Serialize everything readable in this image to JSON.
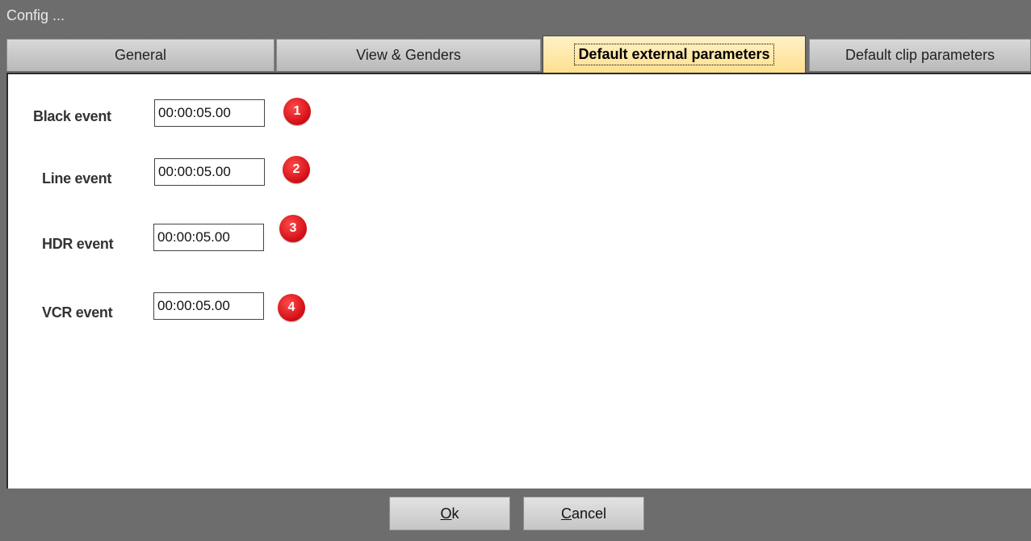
{
  "window": {
    "title": "Config ..."
  },
  "tabs": [
    {
      "label": "General"
    },
    {
      "label": "View & Genders"
    },
    {
      "label": "Default external parameters"
    },
    {
      "label": "Default clip parameters"
    }
  ],
  "fields": [
    {
      "label": "Black event",
      "value": "00:00:05.00",
      "badge": "1"
    },
    {
      "label": "Line event",
      "value": "00:00:05.00",
      "badge": "2"
    },
    {
      "label": "HDR event",
      "value": "00:00:05.00",
      "badge": "3"
    },
    {
      "label": "VCR event",
      "value": "00:00:05.00",
      "badge": "4"
    }
  ],
  "buttons": {
    "ok_mnemonic": "O",
    "ok_rest": "k",
    "cancel_mnemonic": "C",
    "cancel_rest": "ancel"
  },
  "colors": {
    "badge": "#e0121b",
    "active_tab": "#ffe9a8",
    "chrome": "#6d6d6d"
  }
}
